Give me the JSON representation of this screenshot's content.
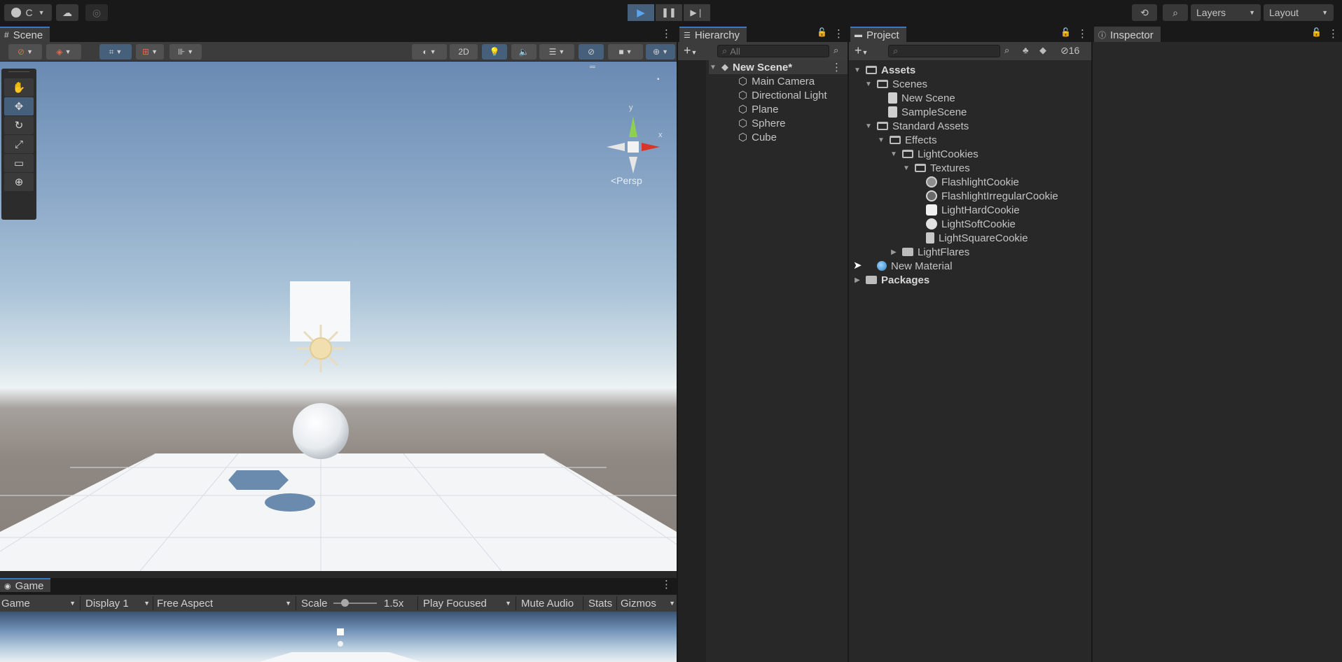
{
  "topbar": {
    "account_label": "C",
    "layers_label": "Layers",
    "layout_label": "Layout"
  },
  "scene": {
    "tab_label": "Scene",
    "toolbar": {
      "mode_2d": "2D"
    },
    "gizmo": {
      "y_label": "y",
      "x_label": "x",
      "persp_label": "<Persp"
    }
  },
  "game": {
    "tab_label": "Game",
    "view_select": "Game",
    "display": "Display 1",
    "aspect": "Free Aspect",
    "scale_label": "Scale",
    "scale_value": "1.5x",
    "play_mode": "Play Focused",
    "mute": "Mute Audio",
    "stats": "Stats",
    "gizmos": "Gizmos"
  },
  "hierarchy": {
    "tab_label": "Hierarchy",
    "search_placeholder": "All",
    "scene_name": "New Scene*",
    "items": [
      "Main Camera",
      "Directional Light",
      "Plane",
      "Sphere",
      "Cube"
    ]
  },
  "project": {
    "tab_label": "Project",
    "hidden_count": "16",
    "assets": "Assets",
    "scenes": "Scenes",
    "scene_files": [
      "New Scene",
      "SampleScene"
    ],
    "standard_assets": "Standard Assets",
    "effects": "Effects",
    "light_cookies": "LightCookies",
    "textures": "Textures",
    "texture_files": [
      "FlashlightCookie",
      "FlashlightIrregularCookie",
      "LightHardCookie",
      "LightSoftCookie",
      "LightSquareCookie"
    ],
    "light_flares": "LightFlares",
    "new_material": "New Material",
    "packages": "Packages"
  },
  "inspector": {
    "tab_label": "Inspector"
  },
  "colors": {
    "accent": "#3a79bb",
    "active_button": "#46607c"
  }
}
